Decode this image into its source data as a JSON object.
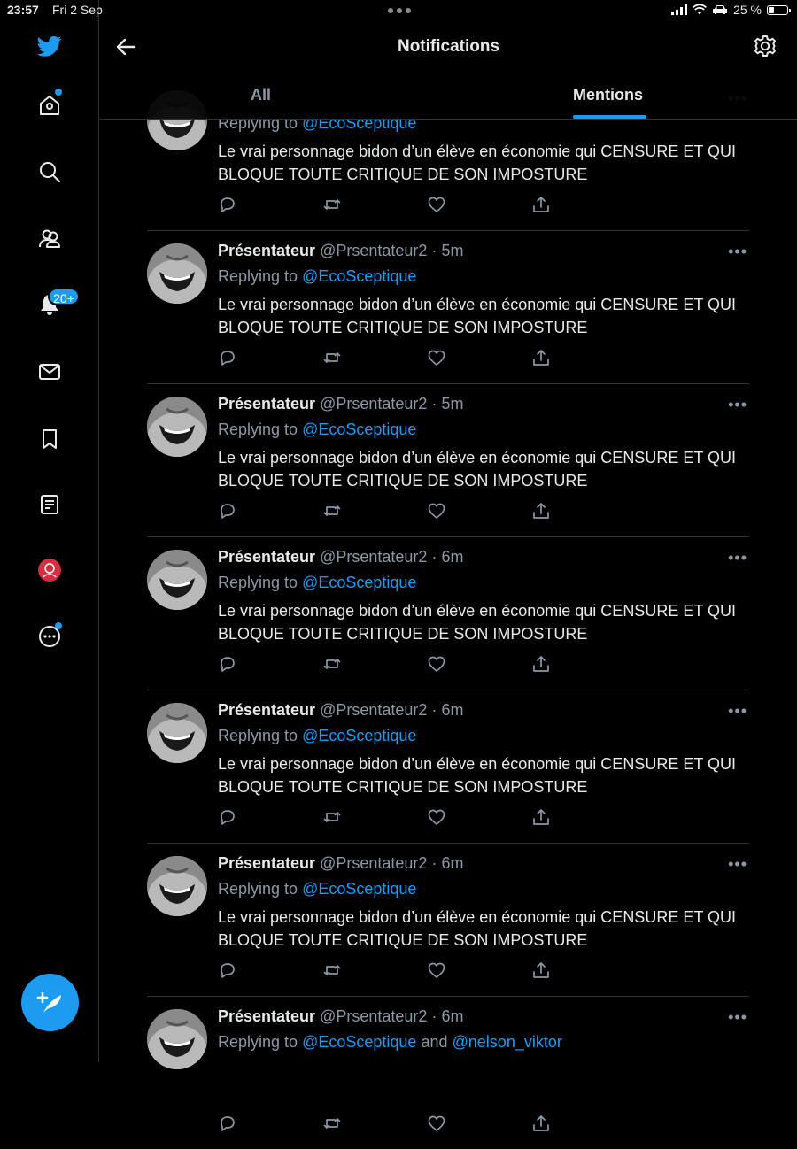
{
  "status_bar": {
    "time": "23:57",
    "date": "Fri 2 Sep",
    "battery": "25 %"
  },
  "header": {
    "title": "Notifications",
    "tabs": [
      {
        "label": "All",
        "active": false
      },
      {
        "label": "Mentions",
        "active": true
      }
    ]
  },
  "sidebar": {
    "notifications_badge": "20+",
    "items": [
      "home-icon",
      "search-icon",
      "communities-icon",
      "notifications-icon",
      "messages-icon",
      "bookmarks-icon",
      "lists-icon",
      "profile-icon",
      "more-icon"
    ]
  },
  "colors": {
    "accent": "#1d9bf0",
    "background": "#000000",
    "muted": "#8b98a5",
    "divider": "#2f3336"
  },
  "tweets": [
    {
      "reply_prefix": "Replying to",
      "mention": "@EcoSceptique",
      "text": "Le vrai personnage bidon d’un élève en économie qui CENSURE ET QUI BLOQUE TOUTE CRITIQUE DE SON IMPOSTURE"
    },
    {
      "name": "Présentateur",
      "handle": "@Prsentateur2",
      "time": "5m",
      "reply_prefix": "Replying to",
      "mention": "@EcoSceptique",
      "text": "Le vrai personnage bidon d’un élève en économie qui CENSURE ET QUI BLOQUE TOUTE CRITIQUE DE SON IMPOSTURE"
    },
    {
      "name": "Présentateur",
      "handle": "@Prsentateur2",
      "time": "5m",
      "reply_prefix": "Replying to",
      "mention": "@EcoSceptique",
      "text": "Le vrai personnage bidon d’un élève en économie qui CENSURE ET QUI BLOQUE TOUTE CRITIQUE DE SON IMPOSTURE"
    },
    {
      "name": "Présentateur",
      "handle": "@Prsentateur2",
      "time": "6m",
      "reply_prefix": "Replying to",
      "mention": "@EcoSceptique",
      "text": "Le vrai personnage bidon d’un élève en économie qui CENSURE ET QUI BLOQUE TOUTE CRITIQUE DE SON IMPOSTURE"
    },
    {
      "name": "Présentateur",
      "handle": "@Prsentateur2",
      "time": "6m",
      "reply_prefix": "Replying to",
      "mention": "@EcoSceptique",
      "text": "Le vrai personnage bidon d’un élève en économie qui CENSURE ET QUI BLOQUE TOUTE CRITIQUE DE SON IMPOSTURE"
    },
    {
      "name": "Présentateur",
      "handle": "@Prsentateur2",
      "time": "6m",
      "reply_prefix": "Replying to",
      "mention": "@EcoSceptique",
      "text": "Le vrai personnage bidon d’un élève en économie qui CENSURE ET QUI BLOQUE TOUTE CRITIQUE DE SON IMPOSTURE"
    },
    {
      "name": "Présentateur",
      "handle": "@Prsentateur2",
      "time": "6m",
      "reply_prefix": "Replying to",
      "mention": "@EcoSceptique",
      "mention_joiner": "and",
      "mention2": "@nelson_viktor",
      "text": ""
    }
  ]
}
